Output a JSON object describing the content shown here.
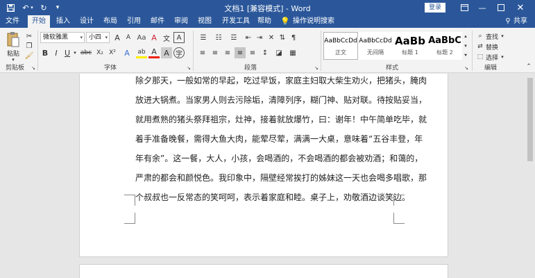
{
  "window": {
    "title": "文档1 [兼容模式] - Word",
    "login": "登录"
  },
  "tabs": [
    "文件",
    "开始",
    "插入",
    "设计",
    "布局",
    "引用",
    "邮件",
    "审阅",
    "视图",
    "开发工具",
    "帮助"
  ],
  "tell_me": "操作说明搜索",
  "share": "共享",
  "ribbon": {
    "paste": "粘贴",
    "clipboard": "剪贴板",
    "font_name": "微软雅黑",
    "font_size": "小四",
    "font": "字体",
    "paragraph": "段落",
    "styles_label": "样式",
    "editing": "编辑",
    "find": "查找",
    "replace": "替换",
    "select": "选择",
    "styles": [
      {
        "preview": "AaBbCcDd",
        "name": "正文"
      },
      {
        "preview": "AaBbCcDd",
        "name": "无间隔"
      },
      {
        "preview": "AaBb",
        "name": "标题 1"
      },
      {
        "preview": "AaBbC",
        "name": "标题 2"
      }
    ],
    "font_buttons": {
      "bold": "B",
      "italic": "I",
      "underline": "U",
      "strike": "abc",
      "sub": "X₂",
      "sup": "X²",
      "highlight": "ab",
      "fontcolor": "A",
      "grow": "A",
      "shrink": "A",
      "clear": "A",
      "phonetic": "文",
      "charborder": "A"
    }
  },
  "document": {
    "lines": [
      "除夕那天，一般如常的早起，吃过早饭，家庭主妇取大柴生劝火，把猪头，腌肉",
      "放进大锅煮。当家男人则去污除垢，清障列序，糊门神、贴对联。待按贴妥当，",
      "就用煮熟的猪头祭拜祖宗，灶神，接着就放爆竹，曰：谢年！中午简单吃毕，就",
      "着手准备晚餐，需得大鱼大肉，能荤尽荤，满满一大桌，意味着“五谷丰登，年",
      "年有余”。这一餐，大人，小孩，会喝酒的，不会喝酒的都会被劝酒；和蔼的，",
      "严肃的都会和颜悦色。我印象中，隔壁经常挨打的姊妹这一天也会喝多唱歌，那",
      "个叔叔也一反常态的笑呵呵，表示着家庭和睦。桌子上，劝敬酒边谈笑边。"
    ]
  }
}
